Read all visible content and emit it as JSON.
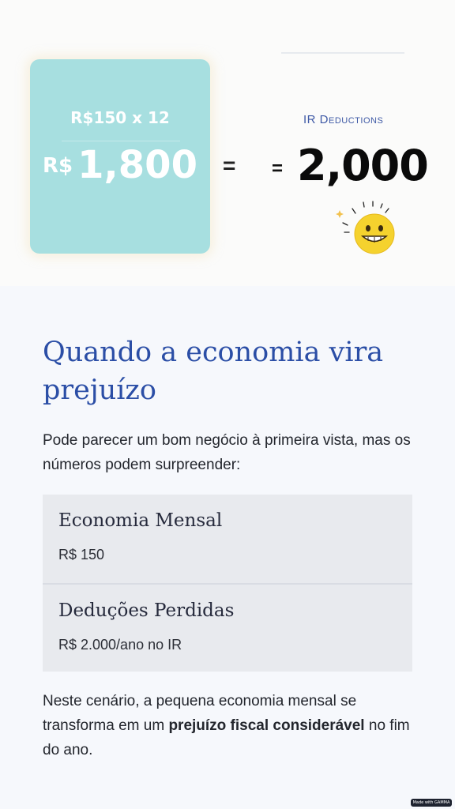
{
  "hero": {
    "calc_top": "R$150 x 12",
    "calc_currency": "R$",
    "calc_value": "1,800",
    "equals_sign": "=",
    "ir_label": "IR Deductions",
    "big_equals": "=",
    "big_value": "2,000",
    "emoji": "grinning-face"
  },
  "content": {
    "title": "Quando a economia vira prejuízo",
    "intro": "Pode parecer um bom negócio à primeira vista, mas os números podem surpreender:",
    "rows": [
      {
        "title": "Economia Mensal",
        "value": "R$ 150"
      },
      {
        "title": "Deduções Perdidas",
        "value": "R$ 2.000/ano no IR"
      }
    ],
    "closing_pre": "Neste cenário, a pequena economia mensal se transforma em um ",
    "closing_bold": "prejuízo fiscal considerável",
    "closing_post": " no fim do ano."
  },
  "badge": {
    "text": "Made with GAMMA"
  },
  "colors": {
    "accent_blue": "#2b4ea6",
    "teal_card": "#a7dfe0",
    "panel_bg": "#e8eaee",
    "smiley_yellow": "#f5d22e"
  }
}
